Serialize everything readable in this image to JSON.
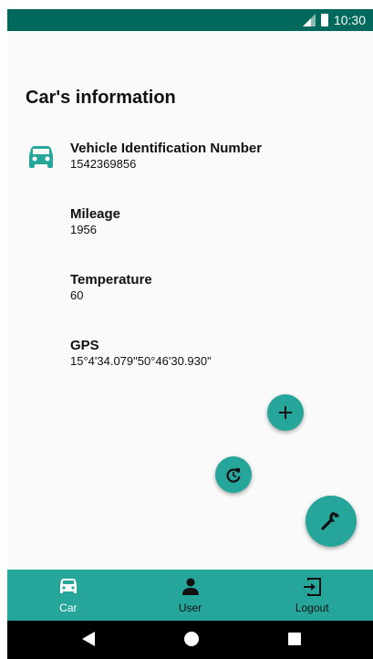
{
  "status_bar": {
    "time": "10:30",
    "icons": [
      "signal-icon",
      "battery-icon"
    ]
  },
  "page": {
    "title": "Car's information"
  },
  "fields": [
    {
      "label": "Vehicle Identification Number",
      "value": "1542369856"
    },
    {
      "label": "Mileage",
      "value": "1956"
    },
    {
      "label": "Temperature",
      "value": "60"
    },
    {
      "label": "GPS",
      "value": "15°4'34.079\"50°46'30.930\""
    }
  ],
  "fabs": {
    "add": "plus-icon",
    "refresh": "refresh-icon",
    "service": "wrench-icon"
  },
  "bottom_nav": {
    "items": [
      {
        "label": "Car",
        "icon": "car-icon",
        "active": true
      },
      {
        "label": "User",
        "icon": "person-icon",
        "active": false
      },
      {
        "label": "Logout",
        "icon": "logout-icon",
        "active": false
      }
    ]
  },
  "colors": {
    "status_bar": "#00695c",
    "accent": "#26a69a",
    "icon_teal": "#26a69a"
  }
}
